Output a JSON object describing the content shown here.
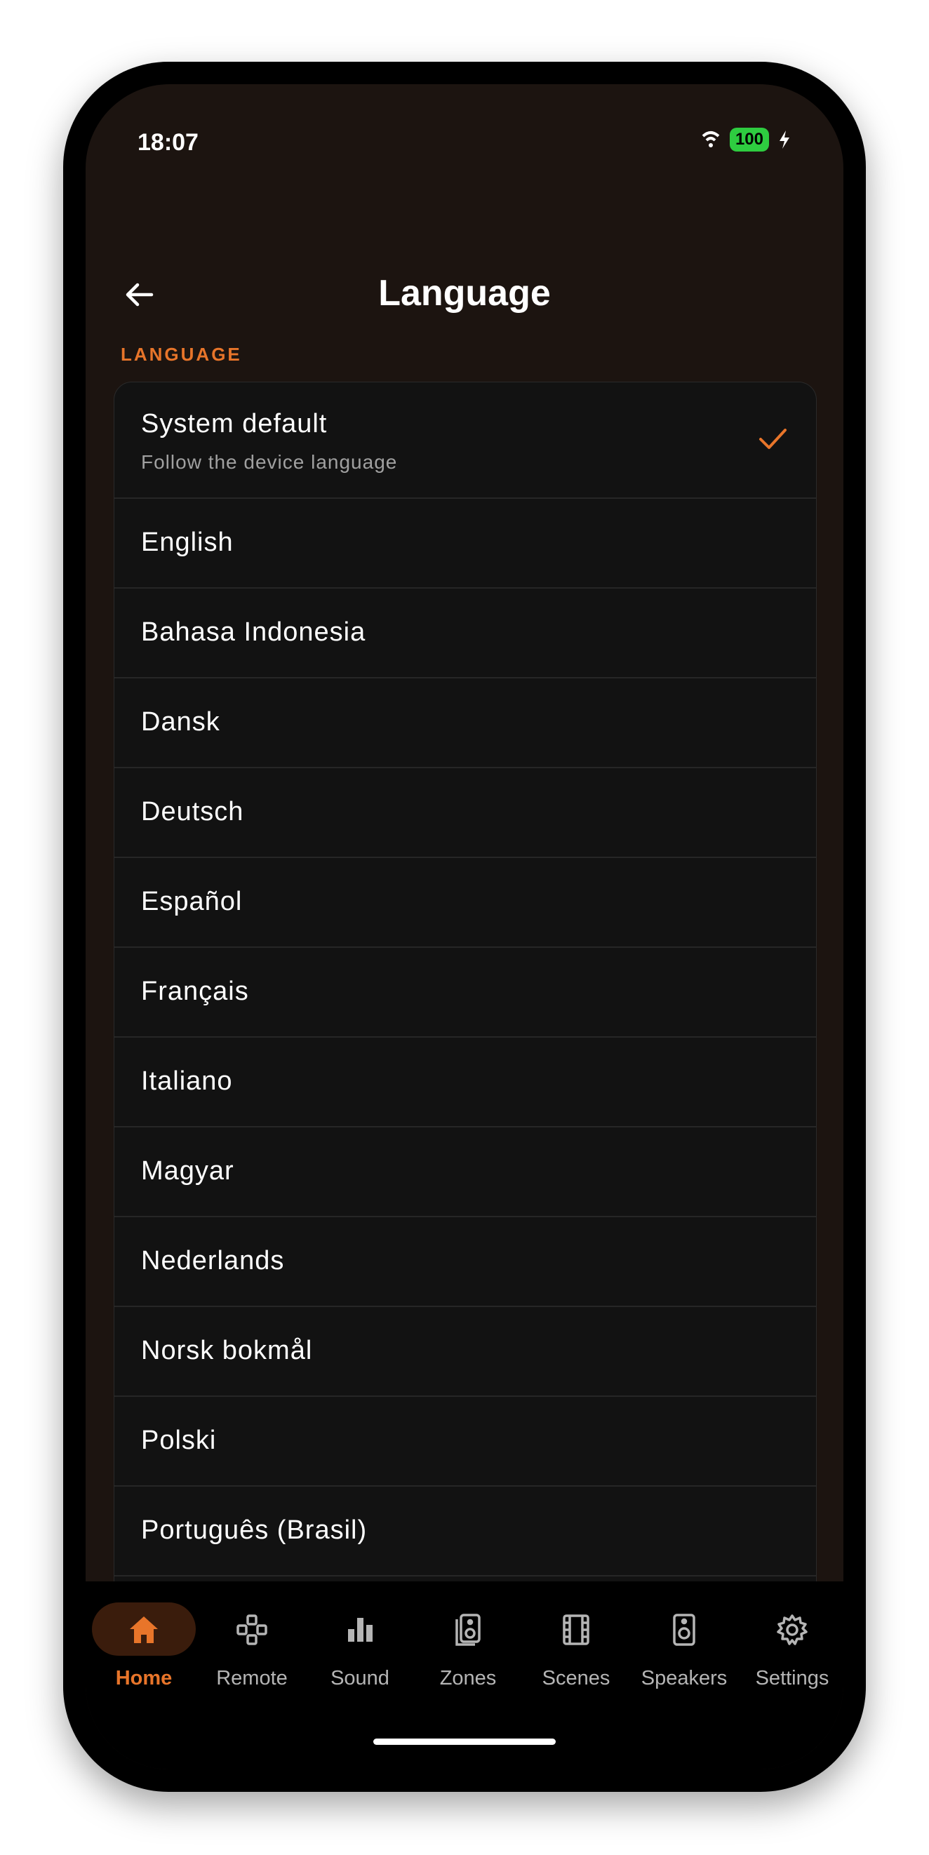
{
  "status_bar": {
    "time": "18:07",
    "battery": "100"
  },
  "header": {
    "title": "Language"
  },
  "section": {
    "label": "LANGUAGE"
  },
  "languages": [
    {
      "label": "System default",
      "subtitle": "Follow the device language",
      "selected": true
    },
    {
      "label": "English"
    },
    {
      "label": "Bahasa Indonesia"
    },
    {
      "label": "Dansk"
    },
    {
      "label": "Deutsch"
    },
    {
      "label": "Español"
    },
    {
      "label": "Français"
    },
    {
      "label": "Italiano"
    },
    {
      "label": "Magyar"
    },
    {
      "label": "Nederlands"
    },
    {
      "label": "Norsk bokmål"
    },
    {
      "label": "Polski"
    },
    {
      "label": "Português (Brasil)"
    }
  ],
  "nav": [
    {
      "label": "Home",
      "icon": "home-icon",
      "active": true
    },
    {
      "label": "Remote",
      "icon": "remote-icon"
    },
    {
      "label": "Sound",
      "icon": "sound-icon"
    },
    {
      "label": "Zones",
      "icon": "zones-icon"
    },
    {
      "label": "Scenes",
      "icon": "scenes-icon"
    },
    {
      "label": "Speakers",
      "icon": "speakers-icon"
    },
    {
      "label": "Settings",
      "icon": "settings-icon"
    }
  ],
  "colors": {
    "accent": "#e8752a",
    "background": "#1c1410",
    "list_bg": "#121212"
  }
}
